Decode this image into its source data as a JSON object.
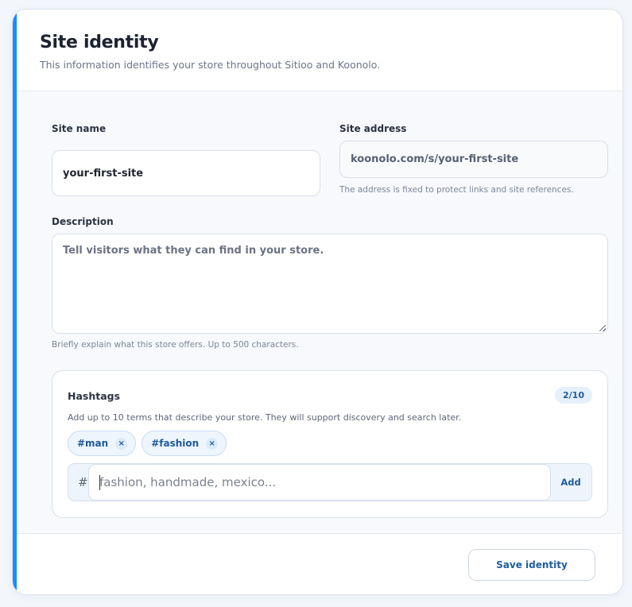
{
  "header": {
    "title": "Site identity",
    "subtitle": "This information identifies your store throughout Sitioo and Koonolo."
  },
  "site_name": {
    "label": "Site name",
    "value": "your-first-site"
  },
  "site_address": {
    "label": "Site address",
    "value": "koonolo.com/s/your-first-site",
    "help": "The address is fixed to protect links and site references."
  },
  "description": {
    "label": "Description",
    "placeholder": "Tell visitors what they can find in your store.",
    "help": "Briefly explain what this store offers. Up to 500 characters."
  },
  "hashtags": {
    "title": "Hashtags",
    "counter": "2/10",
    "help": "Add up to 10 terms that describe your store. They will support discovery and search later.",
    "tags": [
      {
        "label": "#man",
        "remove": "×"
      },
      {
        "label": "#fashion",
        "remove": "×"
      }
    ],
    "prefix": "#",
    "input_placeholder": "fashion, handmade, mexico...",
    "add_label": "Add"
  },
  "footer": {
    "save_label": "Save identity"
  },
  "colors": {
    "accent": "#1a8cff",
    "link_blue": "#1f5d9c",
    "chip_bg": "#eef5fd"
  }
}
